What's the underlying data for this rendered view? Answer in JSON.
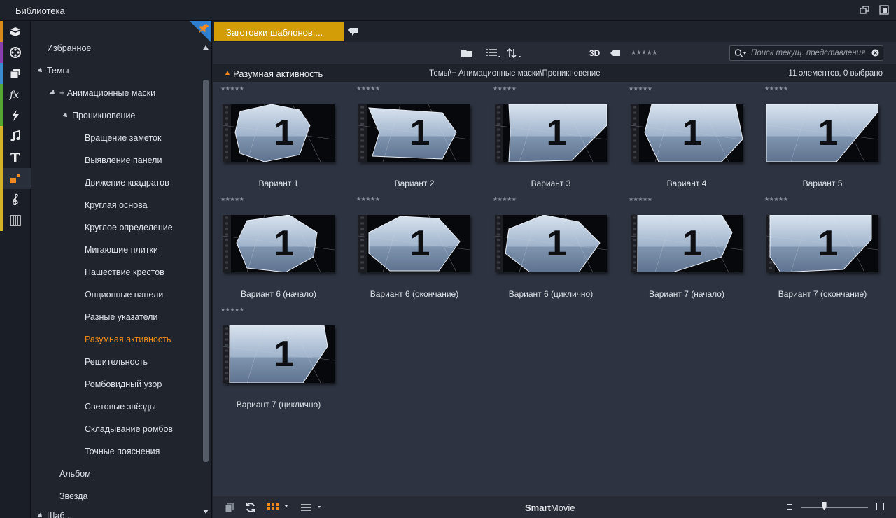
{
  "window": {
    "title": "Библиотека"
  },
  "sidebar_icons": [
    {
      "name": "media-box-icon",
      "color": "#d98a1a"
    },
    {
      "name": "film-reel-icon",
      "color": "#8a3fb0"
    },
    {
      "name": "photos-icon",
      "color": "#3b8bd0"
    },
    {
      "name": "fx-icon",
      "color": "#58a632"
    },
    {
      "name": "lightning-icon",
      "color": "#58a632"
    },
    {
      "name": "music-note-icon",
      "color": "#d3b226"
    },
    {
      "name": "title-t-icon",
      "color": "#d3b226"
    },
    {
      "name": "montage-icon",
      "color": "#d3b226"
    },
    {
      "name": "treble-clef-icon",
      "color": "#d3b226"
    },
    {
      "name": "piano-icon",
      "color": "#d3b226"
    }
  ],
  "tree": {
    "favorites": "Избранное",
    "themes": "Темы",
    "animated_masks": "+ Анимационные маски",
    "penetration": "Проникновение",
    "items": [
      "Вращение заметок",
      "Выявление панели",
      "Движение квадратов",
      "Круглая основа",
      "Круглое определение",
      "Мигающие плитки",
      "Нашествие крестов",
      "Опционные панели",
      "Разные указатели",
      "Разумная активность",
      "Решительность",
      "Ромбовидный узор",
      "Световые звёзды",
      "Складывание ромбов",
      "Точные пояснения"
    ],
    "album": "Альбом",
    "star": "Звезда",
    "partial": "Шаб..."
  },
  "tabs": {
    "active_label": "Заготовки шаблонов:..."
  },
  "toolbar": {
    "label_3d": "3D",
    "rating_stars": "★★★★★",
    "search_placeholder": "Поиск текущ. представления"
  },
  "pathbar": {
    "folder_name": "Разумная активность",
    "path": "Темы\\+ Анимационные маски\\Проникновение",
    "count": "11 элементов, 0 выбрано"
  },
  "tiles": [
    {
      "label": "Вариант 1",
      "stars": "★★★★★"
    },
    {
      "label": "Вариант 2",
      "stars": "★★★★★"
    },
    {
      "label": "Вариант 3",
      "stars": "★★★★★"
    },
    {
      "label": "Вариант 4",
      "stars": "★★★★★"
    },
    {
      "label": "Вариант 5",
      "stars": "★★★★★"
    },
    {
      "label": "Вариант 6 (начало)",
      "stars": "★★★★★"
    },
    {
      "label": "Вариант 6 (окончание)",
      "stars": "★★★★★"
    },
    {
      "label": "Вариант 6 (циклично)",
      "stars": "★★★★★"
    },
    {
      "label": "Вариант 7 (начало)",
      "stars": "★★★★★"
    },
    {
      "label": "Вариант 7 (окончание)",
      "stars": "★★★★★"
    },
    {
      "label": "Вариант 7 (циклично)",
      "stars": "★★★★★"
    }
  ],
  "thumb_digit": "1",
  "bottom": {
    "brand_bold": "Smart",
    "brand_rest": "Movie"
  },
  "zoom_level": 0.35,
  "colors": {
    "accent": "#f08a1c",
    "tab_active": "#d29d06"
  }
}
